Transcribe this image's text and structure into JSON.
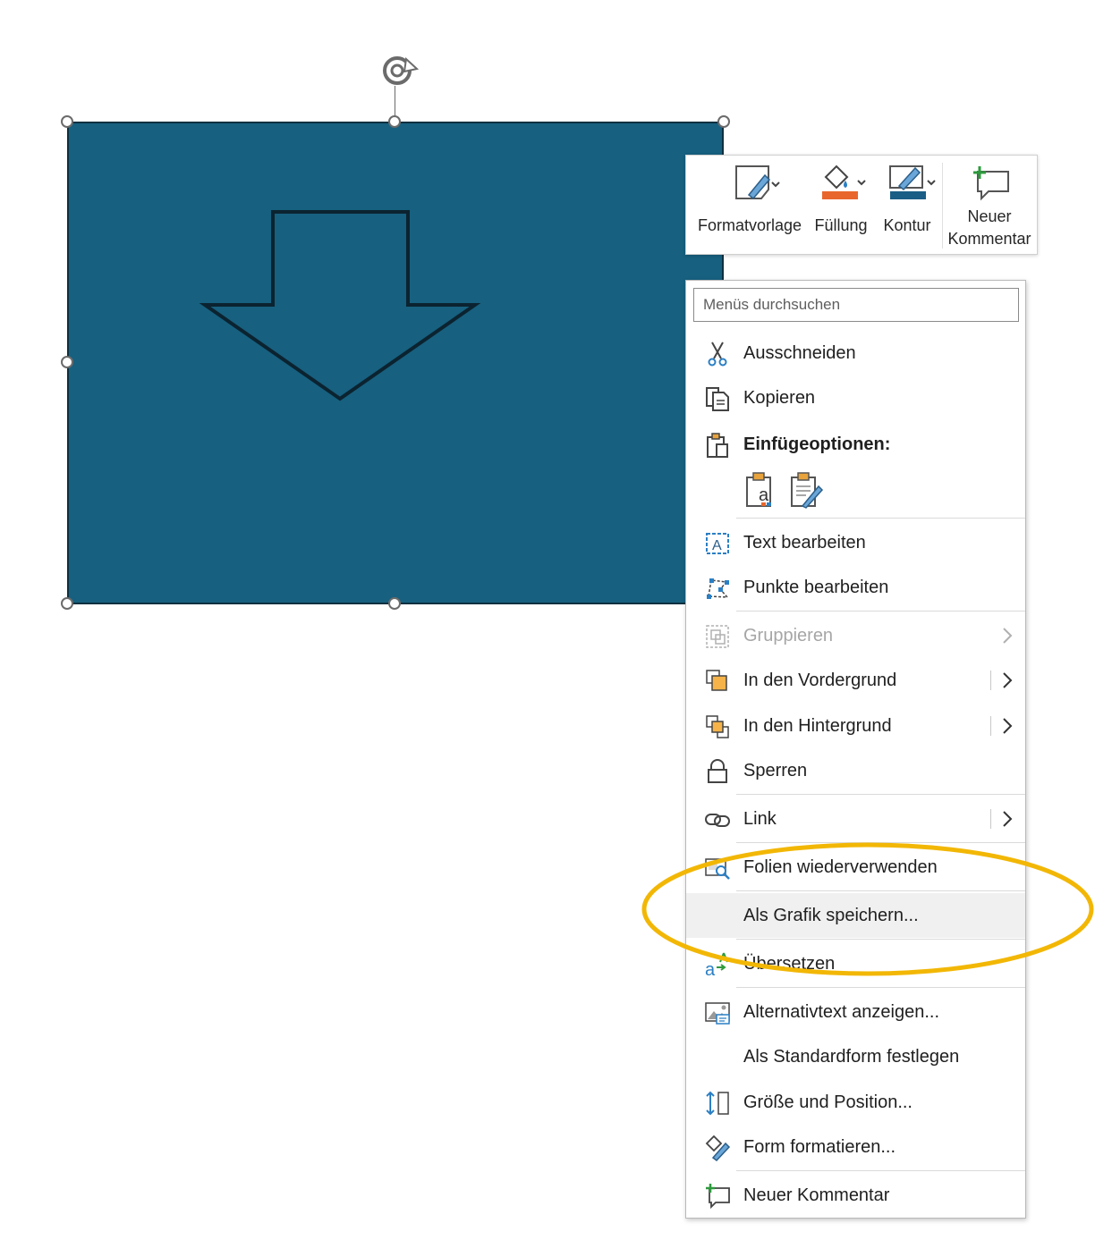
{
  "minibar": {
    "style_label": "Formatvorlage",
    "fill_label": "Füllung",
    "outline_label": "Kontur",
    "comment_label_line1": "Neuer",
    "comment_label_line2": "Kommentar",
    "fill_color": "#e8662c",
    "outline_color": "#1a5e86"
  },
  "menu": {
    "search_placeholder": "Menüs durchsuchen",
    "items": [
      {
        "label": "Ausschneiden",
        "icon": "scissors-icon"
      },
      {
        "label": "Kopieren",
        "icon": "copy-icon"
      },
      {
        "label": "Einfügeoptionen:",
        "icon": "paste-icon"
      },
      {
        "label": "Text bearbeiten",
        "icon": "edit-text-icon"
      },
      {
        "label": "Punkte bearbeiten",
        "icon": "edit-points-icon"
      },
      {
        "label": "Gruppieren",
        "icon": "group-icon",
        "disabled": true
      },
      {
        "label": "In den Vordergrund",
        "icon": "bring-forward-icon"
      },
      {
        "label": "In den Hintergrund",
        "icon": "send-backward-icon"
      },
      {
        "label": "Sperren",
        "icon": "lock-icon"
      },
      {
        "label": "Link",
        "icon": "link-icon"
      },
      {
        "label": "Folien wiederverwenden",
        "icon": "reuse-slides-icon"
      },
      {
        "label": "Als Grafik speichern...",
        "icon": ""
      },
      {
        "label": "Übersetzen",
        "icon": "translate-icon"
      },
      {
        "label": "Alternativtext anzeigen...",
        "icon": "alt-text-icon"
      },
      {
        "label": "Als Standardform festlegen",
        "icon": ""
      },
      {
        "label": "Größe und Position...",
        "icon": "size-position-icon"
      },
      {
        "label": "Form formatieren...",
        "icon": "format-shape-icon"
      },
      {
        "label": "Neuer Kommentar",
        "icon": "new-comment-icon"
      }
    ]
  },
  "colors": {
    "shape_fill": "#17607f",
    "highlight_ellipse": "#f2b705"
  }
}
